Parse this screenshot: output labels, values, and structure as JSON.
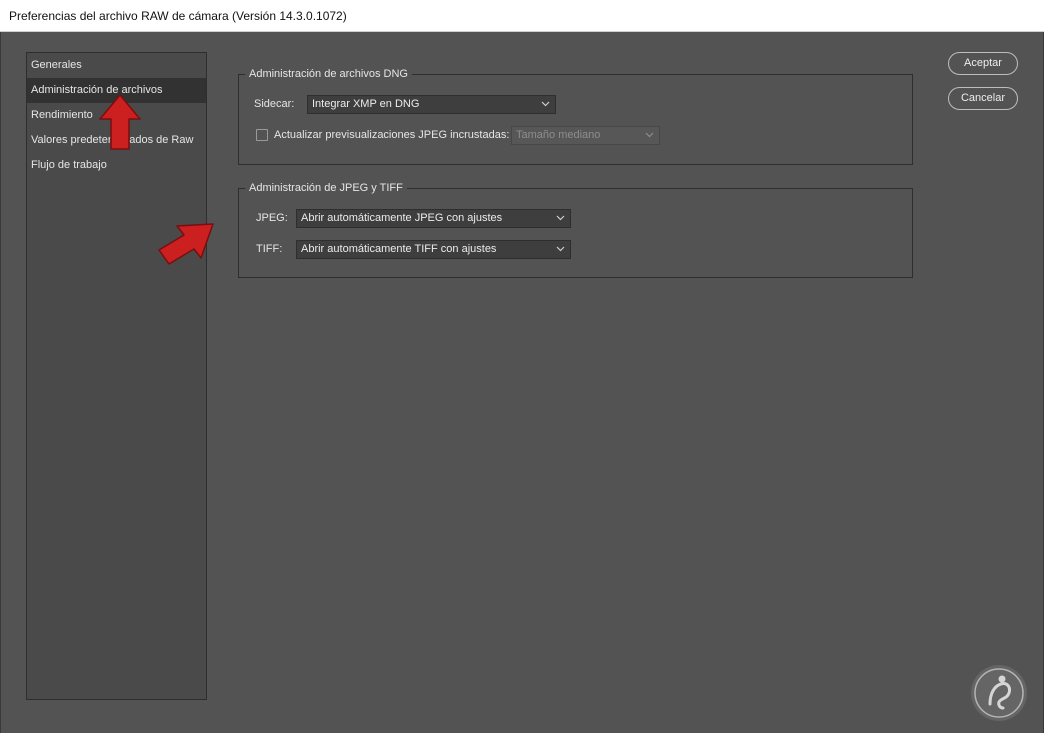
{
  "window": {
    "title": "Preferencias del archivo RAW de cámara  (Versión 14.3.0.1072)"
  },
  "sidebar": {
    "items": [
      {
        "label": "Generales"
      },
      {
        "label": "Administración de archivos",
        "selected": true
      },
      {
        "label": "Rendimiento"
      },
      {
        "label": "Valores predeterminados de Raw"
      },
      {
        "label": "Flujo de trabajo"
      }
    ]
  },
  "dng_group": {
    "title": "Administración de archivos DNG",
    "sidecar_label": "Sidecar:",
    "sidecar_value": "Integrar XMP en DNG",
    "update_previews_label": "Actualizar previsualizaciones JPEG incrustadas:",
    "update_previews_checked": false,
    "preview_size_value": "Tamaño mediano"
  },
  "jpeg_tiff_group": {
    "title": "Administración de JPEG y TIFF",
    "jpeg_label": "JPEG:",
    "jpeg_value": "Abrir automáticamente JPEG con ajustes",
    "tiff_label": "TIFF:",
    "tiff_value": "Abrir automáticamente TIFF con ajustes"
  },
  "buttons": {
    "ok": "Aceptar",
    "cancel": "Cancelar"
  },
  "colors": {
    "background": "#535353",
    "annotation_arrow": "#cc1f1f"
  }
}
